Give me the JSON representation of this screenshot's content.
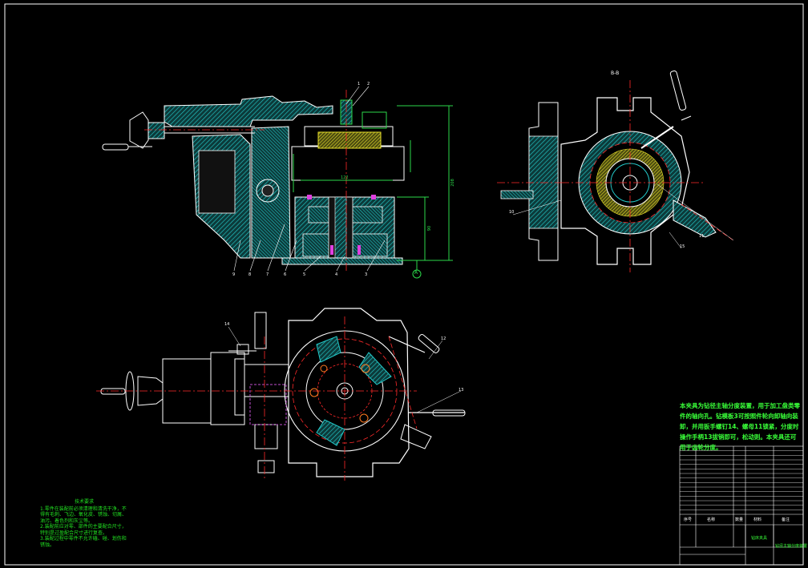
{
  "drawing": {
    "background": "#000000",
    "colors": {
      "frame": "#ffffff",
      "hatch": "#23c8c8",
      "centerline": "#ff2a2a",
      "dimension": "#2bd94a",
      "fixture_part": "#e8e02a",
      "workpiece": "#c050d0",
      "text": "#39ff39"
    }
  },
  "section_label": "B-B",
  "callouts_main": [
    "1",
    "2",
    "3",
    "4",
    "5",
    "6",
    "7",
    "8",
    "9"
  ],
  "callouts_plan": [
    "10",
    "11",
    "12",
    "13"
  ],
  "callouts_side": [
    "14",
    "15"
  ],
  "dimension_values": [
    "122",
    "90",
    "208"
  ],
  "datum_mark": "A",
  "tech_requirements": {
    "title": "技术要求",
    "lines": [
      "1.零件在装配前必须清理和清洗干净，不得有毛刺、飞边、氧化皮、锈蚀、切屑、油污、着色剂和灰尘等。",
      "2.装配前应对零、部件的主要配合尺寸，特别是过盈配合尺寸进行复查。",
      "3.装配过程中零件不允许磕、碰、划伤和锈蚀。"
    ]
  },
  "description": "本夹具为钻径主轴分度装置，用于加工盘类零件的轴向孔。钻模板3可按照件轮向卸轴向装卸，并用扳手螺钉14、螺母11锁紧，分度时操作手柄13拔销即可，松动则。本夹具还可用于齿轮分度。",
  "title_block": {
    "header_labels": [
      "序号",
      "名称",
      "数量",
      "材料",
      "备注"
    ],
    "part_rows": 15,
    "fixture_name": "钻床夹具",
    "drawing_name": "钻径主轴分度装置"
  }
}
